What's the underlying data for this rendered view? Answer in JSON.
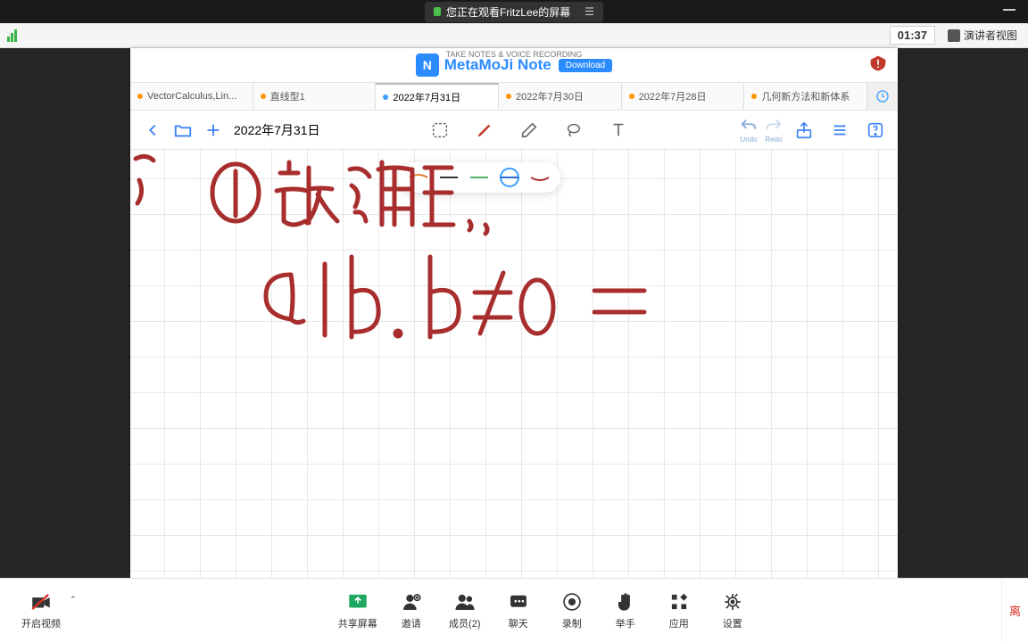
{
  "share": {
    "text": "您正在观看FritzLee的屏幕",
    "menu": "☰"
  },
  "info": {
    "timer": "01:37",
    "presenter": "演讲者视图"
  },
  "ipad": {
    "banner_sub": "TAKE NOTES & VOICE RECORDING",
    "banner_title": "MetaMoJi Note",
    "download": "Download",
    "tabs": [
      {
        "label": "VectorCalculus,Lin..."
      },
      {
        "label": "直线型1"
      },
      {
        "label": "2022年7月31日",
        "active": true
      },
      {
        "label": "2022年7月30日"
      },
      {
        "label": "2022年7月28日"
      },
      {
        "label": "几何新方法和新体系"
      }
    ],
    "doc_title": "2022年7月31日",
    "undo": "Undo",
    "redo": "Redo"
  },
  "palette": {
    "colors": [
      "#e07b2e",
      "#333333",
      "#4fb36b",
      "#2b6bd1",
      "#b23a3a"
    ],
    "selected": 3
  },
  "handwriting": {
    "line1": "① 放缩..",
    "line2": "a|b. b≠0 ="
  },
  "bottom": {
    "video": "开启视频",
    "share": "共享屏幕",
    "invite": "邀请",
    "members": "成员(2)",
    "chat": "聊天",
    "record": "录制",
    "hand": "举手",
    "apps": "应用",
    "settings": "设置",
    "leave": "离"
  }
}
